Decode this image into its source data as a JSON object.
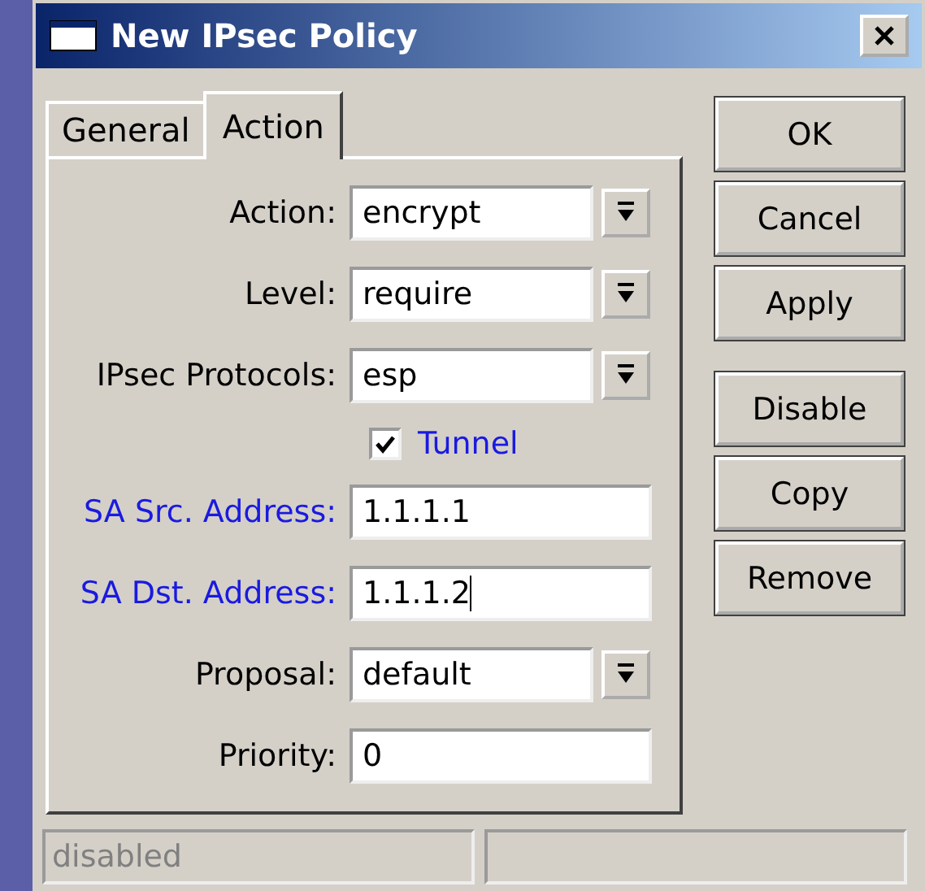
{
  "window": {
    "title": "New IPsec Policy"
  },
  "tabs": [
    {
      "label": "General",
      "selected": false
    },
    {
      "label": "Action",
      "selected": true
    }
  ],
  "fields": [
    {
      "kind": "select",
      "label": "Action:",
      "value": "encrypt",
      "highlighted": false,
      "focused": false
    },
    {
      "kind": "select",
      "label": "Level:",
      "value": "require",
      "highlighted": false,
      "focused": false
    },
    {
      "kind": "select",
      "label": "IPsec Protocols:",
      "value": "esp",
      "highlighted": false,
      "focused": false
    },
    {
      "kind": "checkbox",
      "label": "Tunnel",
      "checked": true,
      "highlighted": true
    },
    {
      "kind": "text",
      "label": "SA Src. Address:",
      "value": "1.1.1.1",
      "highlighted": true,
      "focused": false
    },
    {
      "kind": "text",
      "label": "SA Dst. Address:",
      "value": "1.1.1.2",
      "highlighted": true,
      "focused": true
    },
    {
      "kind": "select",
      "label": "Proposal:",
      "value": "default",
      "highlighted": false,
      "focused": false
    },
    {
      "kind": "text",
      "label": "Priority:",
      "value": "0",
      "highlighted": false,
      "focused": false
    }
  ],
  "button_groups": [
    [
      "OK",
      "Cancel",
      "Apply"
    ],
    [
      "Disable",
      "Copy",
      "Remove"
    ]
  ],
  "status_bar": {
    "state": "disabled"
  }
}
